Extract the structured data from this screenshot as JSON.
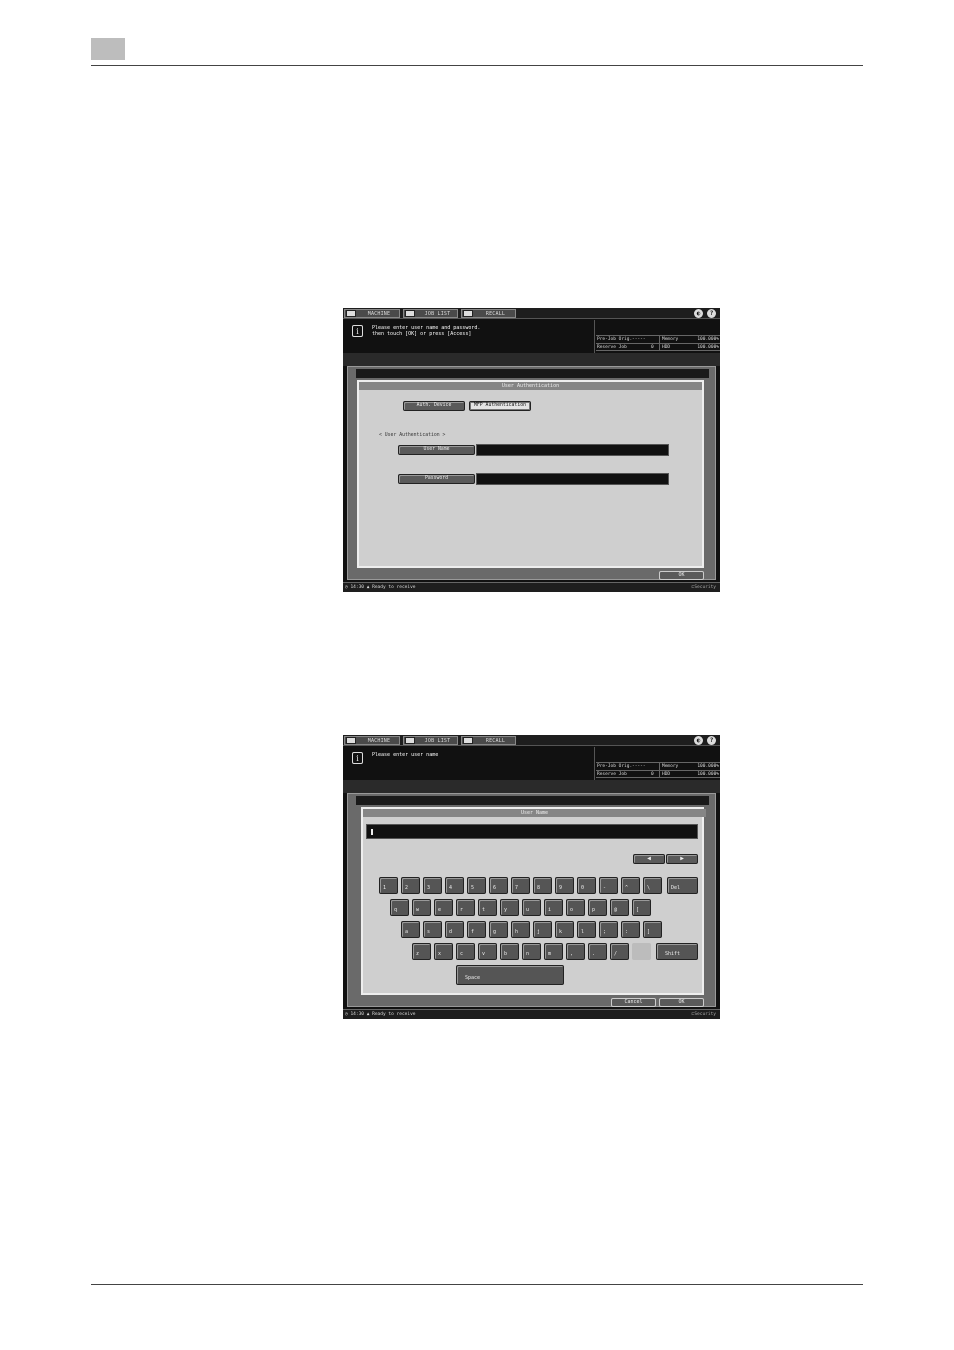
{
  "common": {
    "tabs": [
      "MACHINE",
      "JOB LIST",
      "RECALL"
    ],
    "help_icons": [
      "globe-icon",
      "help-icon"
    ],
    "status": {
      "pre_job_orig_label": "Pre-Job Orig.",
      "pre_job_orig_value": "-----",
      "reserve_job_label": "Reserve Job",
      "reserve_job_value": "0",
      "memory_label": "Memory",
      "memory_value": "100.000%",
      "hdd_label": "HDD",
      "hdd_value": "100.000%"
    },
    "footer_time": "14:30",
    "footer_status": "Ready to receive",
    "footer_right": "Security"
  },
  "screen1": {
    "message": "Please enter user name and password.\nthen touch [OK] or press [Access]",
    "panel_title": "User Authentication",
    "auth_device_label": "Auth. Device",
    "mfp_auth_label": "MFP Authentication",
    "section_label": "< User Authentication >",
    "user_name_label": "User Name",
    "user_name_value": "",
    "password_label": "Password",
    "password_value": "",
    "ok_label": "OK"
  },
  "screen2": {
    "message": "Please enter user name",
    "panel_title": "User Name",
    "input_value": "",
    "arrow_left": "◀",
    "arrow_right": "▶",
    "row1": [
      "1",
      "2",
      "3",
      "4",
      "5",
      "6",
      "7",
      "8",
      "9",
      "0",
      "-",
      "^",
      "\\"
    ],
    "del_label": "Del",
    "row2": [
      "q",
      "w",
      "e",
      "r",
      "t",
      "y",
      "u",
      "i",
      "o",
      "p",
      "@",
      "["
    ],
    "row3": [
      "a",
      "s",
      "d",
      "f",
      "g",
      "h",
      "j",
      "k",
      "l",
      ";",
      ":",
      "]"
    ],
    "row4": [
      "z",
      "x",
      "c",
      "v",
      "b",
      "n",
      "m",
      ",",
      ".",
      "/"
    ],
    "shift_label": "Shift",
    "space_label": "Space",
    "cancel_label": "Cancel",
    "ok_label": "OK"
  }
}
